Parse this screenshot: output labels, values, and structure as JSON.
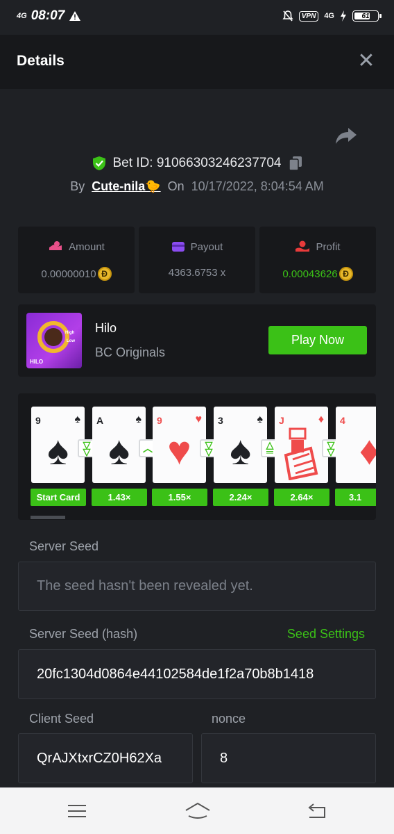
{
  "status_bar": {
    "network": "4G",
    "time": "08:07",
    "vpn": "VPN",
    "network_right": "4G",
    "battery": "61"
  },
  "header": {
    "title": "Details"
  },
  "bet": {
    "id_label": "Bet ID: 910663032462377​04",
    "by_label": "By",
    "user": "Cute-nila🐤",
    "on_label": "On",
    "date": "10/17/2022, 8:04:54 AM"
  },
  "stats": [
    {
      "label": "Amount",
      "value": "0.00000010",
      "color": "#8d929c"
    },
    {
      "label": "Payout",
      "value": "4363.6753 x",
      "color": "#8d929c"
    },
    {
      "label": "Profit",
      "value": "0.00043626",
      "color": "#3bc117"
    }
  ],
  "game": {
    "thumb_tag": "HILO",
    "thumb_high": "High",
    "thumb_low": "Low",
    "name": "Hilo",
    "provider": "BC Originals",
    "play_label": "Play Now"
  },
  "cards": [
    {
      "rank": "9",
      "suit": "♠",
      "color": "black",
      "mult": "Start Card"
    },
    {
      "rank": "A",
      "suit": "♠",
      "color": "black",
      "mult": "1.43×"
    },
    {
      "rank": "9",
      "suit": "♥",
      "color": "red",
      "mult": "1.55×"
    },
    {
      "rank": "3",
      "suit": "♠",
      "color": "black",
      "mult": "2.24×"
    },
    {
      "rank": "J",
      "suit": "♦",
      "color": "red",
      "mult": "2.64×"
    },
    {
      "rank": "4",
      "suit": "♦",
      "color": "red",
      "mult": "3.1"
    }
  ],
  "seeds": {
    "server_label": "Server Seed",
    "server_value": "The seed hasn't been revealed yet.",
    "hash_label": "Server Seed (hash)",
    "settings_label": "Seed Settings",
    "hash_value": "20fc1304d0864e44102584de1f2a70b8b1418",
    "client_label": "Client Seed",
    "client_value": "QrAJXtxrCZ0H62Xa",
    "nonce_label": "nonce",
    "nonce_value": "8"
  },
  "colors": {
    "accent": "#3bc117",
    "background": "#1f2125",
    "panel": "#17181b"
  }
}
